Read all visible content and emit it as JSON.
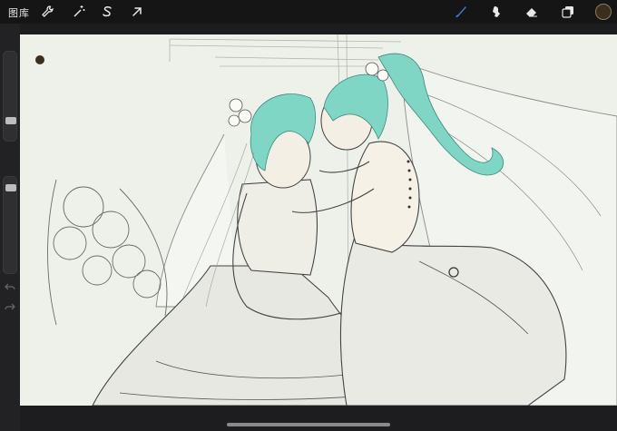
{
  "toolbar": {
    "gallery_label": "图库",
    "actions": [
      {
        "icon": "wrench-icon"
      },
      {
        "icon": "magic-wand-icon"
      },
      {
        "icon": "selection-s-icon"
      },
      {
        "icon": "transform-arrow-icon"
      }
    ],
    "tools": [
      {
        "icon": "brush-icon",
        "active": true
      },
      {
        "icon": "smudge-icon",
        "active": false
      },
      {
        "icon": "eraser-icon",
        "active": false
      },
      {
        "icon": "layers-icon",
        "active": false
      }
    ],
    "current_color": "#3a2e1e"
  },
  "sidebar": {
    "brush_size_level": 0.35,
    "opacity_level": 0.1
  },
  "colors": {
    "accent": "#3a7bd5",
    "canvas": "#eef0ea",
    "hair": "#7fd6c4"
  }
}
